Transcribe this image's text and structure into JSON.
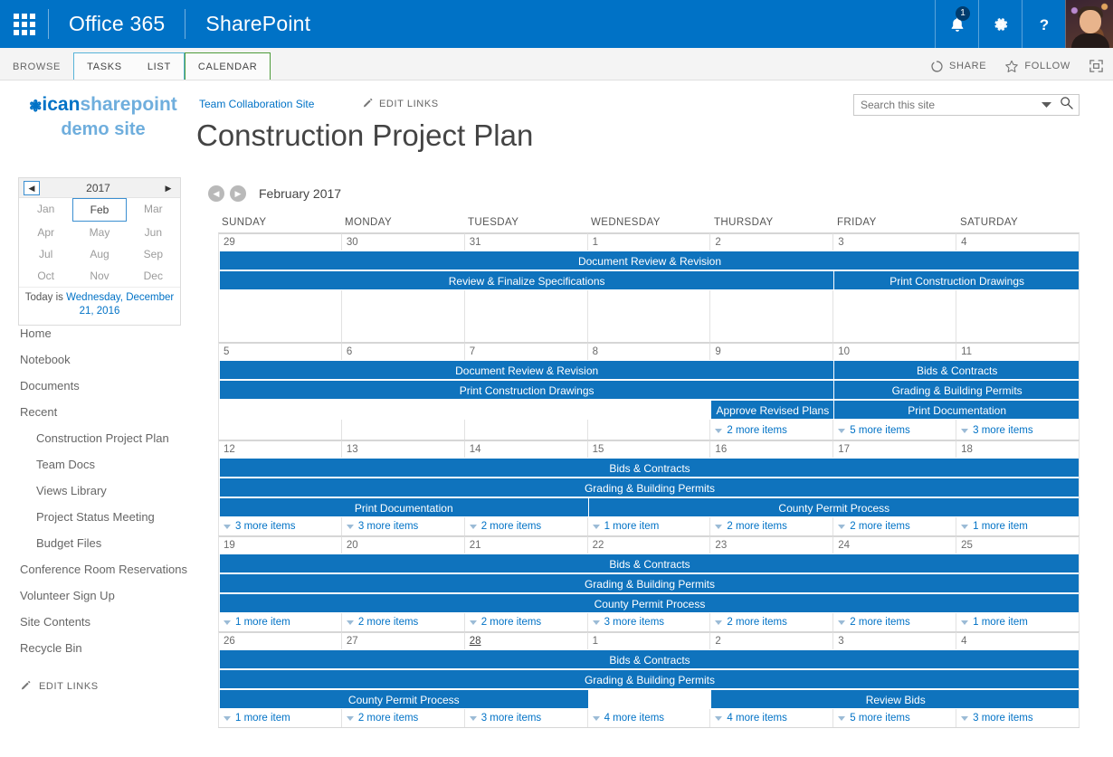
{
  "suite": {
    "waffle": "app-launcher",
    "brand": "Office 365",
    "app": "SharePoint",
    "notification_count": "1"
  },
  "ribbon": {
    "browse": "BROWSE",
    "tasks": "TASKS",
    "list": "LIST",
    "calendar": "CALENDAR",
    "share": "SHARE",
    "follow": "FOLLOW"
  },
  "logo": {
    "line1_left": "ican",
    "line1_right": "sharepoint",
    "line2": "demo site"
  },
  "header": {
    "breadcrumb": "Team Collaboration Site",
    "edit_links": "EDIT LINKS",
    "title": "Construction Project Plan"
  },
  "search": {
    "value": "Search this site",
    "placeholder": "Search this site"
  },
  "datepicker": {
    "year": "2017",
    "months": [
      "Jan",
      "Feb",
      "Mar",
      "Apr",
      "May",
      "Jun",
      "Jul",
      "Aug",
      "Sep",
      "Oct",
      "Nov",
      "Dec"
    ],
    "selected_month": "Feb",
    "today_prefix": "Today is ",
    "today_link": "Wednesday, December 21, 2016"
  },
  "leftnav": {
    "items": [
      {
        "label": "Home",
        "child": false
      },
      {
        "label": "Notebook",
        "child": false
      },
      {
        "label": "Documents",
        "child": false
      },
      {
        "label": "Recent",
        "child": false
      },
      {
        "label": "Construction Project Plan",
        "child": true
      },
      {
        "label": "Team Docs",
        "child": true
      },
      {
        "label": "Views Library",
        "child": true
      },
      {
        "label": "Project Status Meeting",
        "child": true
      },
      {
        "label": "Budget Files",
        "child": true
      },
      {
        "label": "Conference Room Reservations",
        "child": false
      },
      {
        "label": "Volunteer Sign Up",
        "child": false
      },
      {
        "label": "Site Contents",
        "child": false
      },
      {
        "label": "Recycle Bin",
        "child": false
      }
    ],
    "edit_links": "EDIT LINKS"
  },
  "calendar": {
    "current_month": "February 2017",
    "accent_color": "#0f73bd",
    "weekday_headers": [
      "SUNDAY",
      "MONDAY",
      "TUESDAY",
      "WEDNESDAY",
      "THURSDAY",
      "FRIDAY",
      "SATURDAY"
    ],
    "weeks": [
      {
        "days": [
          {
            "num": "29",
            "today": false
          },
          {
            "num": "30",
            "today": false
          },
          {
            "num": "31",
            "today": false
          },
          {
            "num": "1",
            "today": false
          },
          {
            "num": "2",
            "today": false
          },
          {
            "num": "3",
            "today": false
          },
          {
            "num": "4",
            "today": false
          }
        ],
        "bands": [
          [
            {
              "label": "Document Review & Revision",
              "start": 1,
              "span": 7
            }
          ],
          [
            {
              "label": "Review & Finalize Specifications",
              "start": 1,
              "span": 5
            },
            {
              "label": "Print Construction Drawings",
              "start": 6,
              "span": 2
            }
          ]
        ],
        "filler": true,
        "more": [
          "",
          "",
          "",
          "",
          "",
          "",
          ""
        ]
      },
      {
        "days": [
          {
            "num": "5",
            "today": false
          },
          {
            "num": "6",
            "today": false
          },
          {
            "num": "7",
            "today": false
          },
          {
            "num": "8",
            "today": false
          },
          {
            "num": "9",
            "today": false
          },
          {
            "num": "10",
            "today": false
          },
          {
            "num": "11",
            "today": false
          }
        ],
        "bands": [
          [
            {
              "label": "Document Review & Revision",
              "start": 1,
              "span": 5
            },
            {
              "label": "Bids & Contracts",
              "start": 6,
              "span": 2
            }
          ],
          [
            {
              "label": "Print Construction Drawings",
              "start": 1,
              "span": 5
            },
            {
              "label": "Grading & Building Permits",
              "start": 6,
              "span": 2
            }
          ],
          [
            {
              "label": "Approve Revised Plans",
              "start": 5,
              "span": 1
            },
            {
              "label": "Print Documentation",
              "start": 6,
              "span": 2
            }
          ]
        ],
        "filler": false,
        "more": [
          "",
          "",
          "",
          "",
          "2 more items",
          "5 more items",
          "3 more items"
        ]
      },
      {
        "days": [
          {
            "num": "12",
            "today": false
          },
          {
            "num": "13",
            "today": false
          },
          {
            "num": "14",
            "today": false
          },
          {
            "num": "15",
            "today": false
          },
          {
            "num": "16",
            "today": false
          },
          {
            "num": "17",
            "today": false
          },
          {
            "num": "18",
            "today": false
          }
        ],
        "bands": [
          [
            {
              "label": "Bids & Contracts",
              "start": 1,
              "span": 7
            }
          ],
          [
            {
              "label": "Grading & Building Permits",
              "start": 1,
              "span": 7
            }
          ],
          [
            {
              "label": "Print Documentation",
              "start": 1,
              "span": 3
            },
            {
              "label": "County Permit Process",
              "start": 4,
              "span": 4
            }
          ]
        ],
        "filler": false,
        "more": [
          "3 more items",
          "3 more items",
          "2 more items",
          "1 more item",
          "2 more items",
          "2 more items",
          "1 more item"
        ]
      },
      {
        "days": [
          {
            "num": "19",
            "today": false
          },
          {
            "num": "20",
            "today": false
          },
          {
            "num": "21",
            "today": false
          },
          {
            "num": "22",
            "today": false
          },
          {
            "num": "23",
            "today": false
          },
          {
            "num": "24",
            "today": false
          },
          {
            "num": "25",
            "today": false
          }
        ],
        "bands": [
          [
            {
              "label": "Bids & Contracts",
              "start": 1,
              "span": 7
            }
          ],
          [
            {
              "label": "Grading & Building Permits",
              "start": 1,
              "span": 7
            }
          ],
          [
            {
              "label": "County Permit Process",
              "start": 1,
              "span": 7
            }
          ]
        ],
        "filler": false,
        "more": [
          "1 more item",
          "2 more items",
          "2 more items",
          "3 more items",
          "2 more items",
          "2 more items",
          "1 more item"
        ]
      },
      {
        "days": [
          {
            "num": "26",
            "today": false
          },
          {
            "num": "27",
            "today": false
          },
          {
            "num": "28",
            "today": true
          },
          {
            "num": "1",
            "today": false
          },
          {
            "num": "2",
            "today": false
          },
          {
            "num": "3",
            "today": false
          },
          {
            "num": "4",
            "today": false
          }
        ],
        "bands": [
          [
            {
              "label": "Bids & Contracts",
              "start": 1,
              "span": 7
            }
          ],
          [
            {
              "label": "Grading & Building Permits",
              "start": 1,
              "span": 7
            }
          ],
          [
            {
              "label": "County Permit Process",
              "start": 1,
              "span": 3
            },
            {
              "label": "Review Bids",
              "start": 5,
              "span": 3
            }
          ]
        ],
        "filler": false,
        "more": [
          "1 more item",
          "2 more items",
          "3 more items",
          "4 more items",
          "4 more items",
          "5 more items",
          "3 more items"
        ]
      }
    ]
  }
}
